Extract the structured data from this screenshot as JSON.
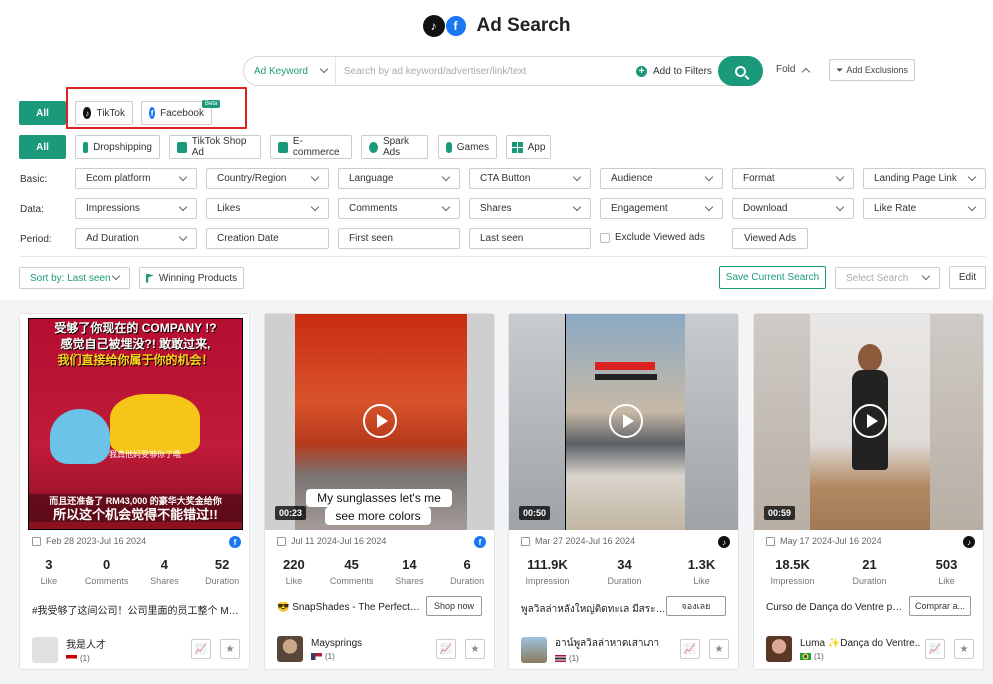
{
  "header": {
    "title": "Ad Search"
  },
  "search": {
    "keyword_type": "Ad Keyword",
    "placeholder": "Search by ad keyword/advertiser/link/text",
    "add_filters": "Add to Filters",
    "fold": "Fold",
    "add_exclusions": "Add Exclusions"
  },
  "platforms": {
    "all": "All",
    "items": [
      {
        "label": "TikTok",
        "icon": "tiktok-icon"
      },
      {
        "label": "Facebook",
        "icon": "facebook-icon",
        "badge": "Beta"
      }
    ]
  },
  "categories": {
    "all": "All",
    "items": [
      "Dropshipping",
      "TikTok Shop Ad",
      "E-commerce",
      "Spark Ads",
      "Games",
      "App"
    ]
  },
  "filters": {
    "basic_label": "Basic:",
    "basic": [
      "Ecom platform",
      "Country/Region",
      "Language",
      "CTA Button",
      "Audience",
      "Format",
      "Landing Page Link"
    ],
    "data_label": "Data:",
    "data": [
      "Impressions",
      "Likes",
      "Comments",
      "Shares",
      "Engagement",
      "Download",
      "Like Rate"
    ],
    "period_label": "Period:",
    "period": [
      "Ad Duration",
      "Creation Date",
      "First seen",
      "Last seen"
    ],
    "exclude_viewed": "Exclude Viewed ads",
    "viewed_ads": "Viewed Ads"
  },
  "toolbar": {
    "sort": "Sort by: Last seen",
    "winning": "Winning Products",
    "save_search": "Save Current Search",
    "select_search": "Select Search",
    "edit": "Edit"
  },
  "cards": [
    {
      "platform": "facebook",
      "date": "Feb 28 2023-Jul 16 2024",
      "stats": [
        {
          "v": "3",
          "l": "Like"
        },
        {
          "v": "0",
          "l": "Comments"
        },
        {
          "v": "4",
          "l": "Shares"
        },
        {
          "v": "52",
          "l": "Duration"
        }
      ],
      "text": "#我受够了这间公司！公司里面的员工整个 Maca...",
      "cta": "",
      "advertiser": "我是人才",
      "count": "(1)",
      "media_top1": "受够了你现在的 COMPANY !?",
      "media_top2": "感觉自己被埋没?! 敢敢过来,",
      "media_top3": "我们直接给你属于你的机会！",
      "media_sub": "我真他妈受够你了哦",
      "media_bottom1": "而且还准备了 RM43,000 的豪华大奖金给你",
      "media_bottom2": "所以这个机会觉得不能错过!!"
    },
    {
      "platform": "facebook",
      "duration": "00:23",
      "date": "Jul 11 2024-Jul 16 2024",
      "stats": [
        {
          "v": "220",
          "l": "Like"
        },
        {
          "v": "45",
          "l": "Comments"
        },
        {
          "v": "14",
          "l": "Shares"
        },
        {
          "v": "6",
          "l": "Duration"
        }
      ],
      "text": "😎 SnapShades - The Perfect Fit...",
      "cta": "Shop now",
      "advertiser": "Maysprings",
      "count": "(1)",
      "caption1": "My sunglasses let's me",
      "caption2": "see more colors"
    },
    {
      "platform": "tiktok",
      "duration": "00:50",
      "date": "Mar 27 2024-Jul 16 2024",
      "stats": [
        {
          "v": "111.9K",
          "l": "Impression"
        },
        {
          "v": "34",
          "l": "Duration"
        },
        {
          "v": "1.3K",
          "l": "Like"
        }
      ],
      "text": "พูลวิลล่าหลังใหญ่ติดทะเล มีสระและ...",
      "cta": "จองเลย",
      "advertiser": "อาน์พูลวิลล่าหาดเสาเภา",
      "count": "(1)"
    },
    {
      "platform": "tiktok",
      "duration": "00:59",
      "date": "May 17 2024-Jul 16 2024",
      "stats": [
        {
          "v": "18.5K",
          "l": "Impression"
        },
        {
          "v": "21",
          "l": "Duration"
        },
        {
          "v": "503",
          "l": "Like"
        }
      ],
      "text": "Curso de Dança do Ventre para...",
      "cta": "Comprar a...",
      "advertiser": "Luma ✨Dança do Ventre...",
      "count": "(1)"
    }
  ],
  "colors": {
    "accent": "#1a9a7b",
    "highlight": "#e02020"
  }
}
